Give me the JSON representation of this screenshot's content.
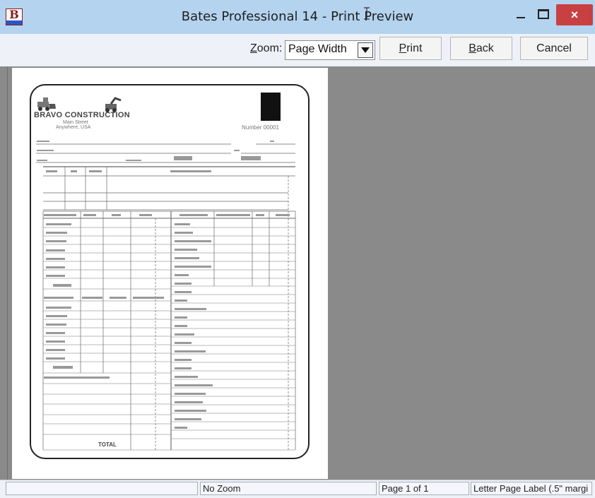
{
  "window": {
    "title": "Bates Professional 14 - Print Preview",
    "close_symbol": "×"
  },
  "toolbar": {
    "zoom_label_prefix": "Z",
    "zoom_label_rest": "oom:",
    "zoom_value": "Page Width",
    "print_prefix": "P",
    "print_rest": "rint",
    "back_prefix": "B",
    "back_rest": "ack",
    "cancel_label": "Cancel"
  },
  "preview": {
    "company": "BRAVO CONSTRUCTION",
    "address_line1": "Main Street",
    "address_line2": "Anywhere, USA",
    "number": "Number 00001",
    "total": "TOTAL"
  },
  "status": {
    "panel1": "",
    "zoom": "No Zoom",
    "page": "Page 1 of 1",
    "label": "Letter Page Label (.5\" margi"
  }
}
